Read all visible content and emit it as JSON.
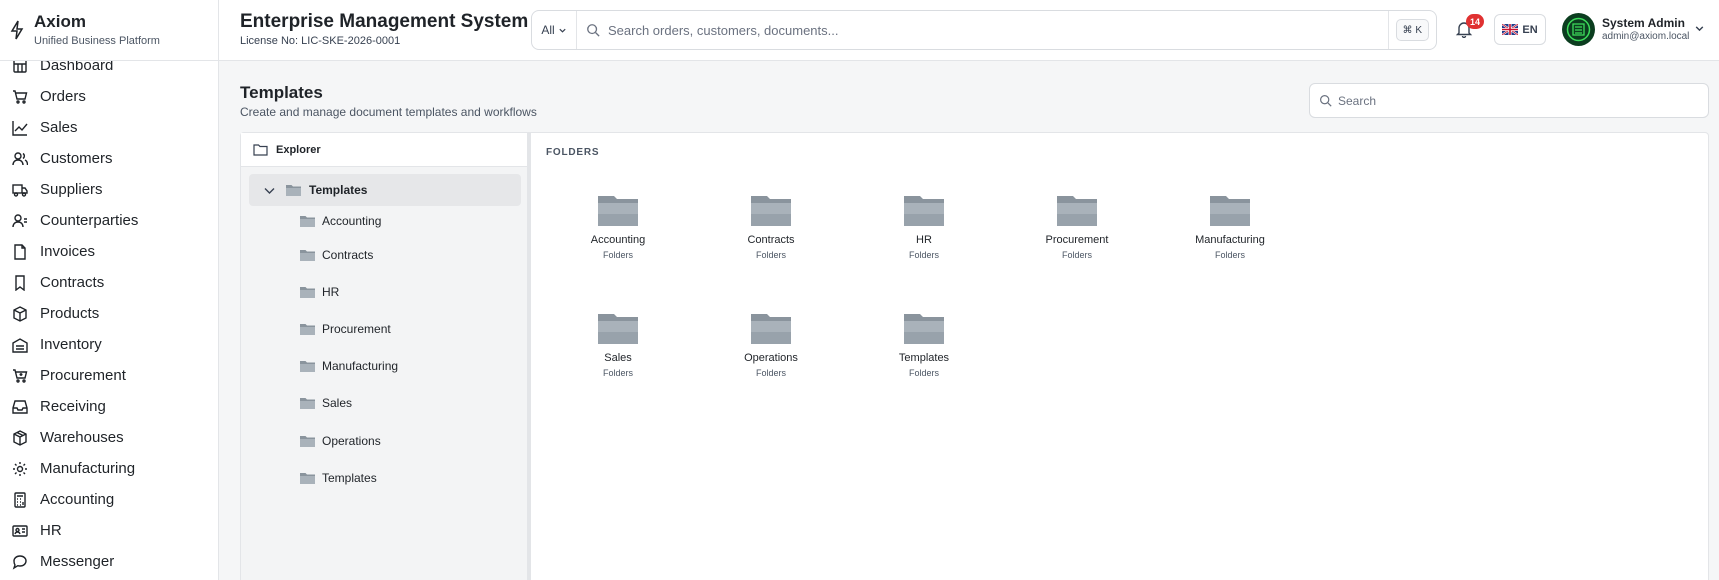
{
  "brand": {
    "name": "Axiom",
    "tagline": "Unified Business Platform"
  },
  "sidebar": {
    "items": [
      {
        "label": "Dashboard",
        "icon": "dashboard-icon"
      },
      {
        "label": "Orders",
        "icon": "cart-icon"
      },
      {
        "label": "Sales",
        "icon": "trend-icon"
      },
      {
        "label": "Customers",
        "icon": "users-icon"
      },
      {
        "label": "Suppliers",
        "icon": "truck-icon"
      },
      {
        "label": "Counterparties",
        "icon": "contact-icon"
      },
      {
        "label": "Invoices",
        "icon": "file-icon"
      },
      {
        "label": "Contracts",
        "icon": "bookmark-icon"
      },
      {
        "label": "Products",
        "icon": "box-icon"
      },
      {
        "label": "Inventory",
        "icon": "warehouse-icon"
      },
      {
        "label": "Procurement",
        "icon": "cart-plus-icon"
      },
      {
        "label": "Receiving",
        "icon": "inbox-icon"
      },
      {
        "label": "Warehouses",
        "icon": "package-icon"
      },
      {
        "label": "Manufacturing",
        "icon": "gear-icon"
      },
      {
        "label": "Accounting",
        "icon": "calculator-icon"
      },
      {
        "label": "HR",
        "icon": "id-card-icon"
      },
      {
        "label": "Messenger",
        "icon": "chat-icon"
      }
    ]
  },
  "header": {
    "title": "Enterprise Management System",
    "license": "License No: LIC-SKE-2026-0001",
    "search": {
      "scope": "All",
      "placeholder": "Search orders, customers, documents...",
      "shortcut": "⌘ K"
    },
    "notifications": "14",
    "language": "EN",
    "user": {
      "name": "System Admin",
      "email": "admin@axiom.local"
    }
  },
  "page": {
    "title": "Templates",
    "subtitle": "Create and manage document templates and workflows",
    "search_placeholder": "Search"
  },
  "explorer": {
    "title": "Explorer",
    "root": "Templates",
    "items": [
      "Accounting",
      "Contracts",
      "HR",
      "Procurement",
      "Manufacturing",
      "Sales",
      "Operations",
      "Templates"
    ]
  },
  "content": {
    "section": "FOLDERS",
    "folders": [
      {
        "name": "Accounting",
        "type": "Folders"
      },
      {
        "name": "Contracts",
        "type": "Folders"
      },
      {
        "name": "HR",
        "type": "Folders"
      },
      {
        "name": "Procurement",
        "type": "Folders"
      },
      {
        "name": "Manufacturing",
        "type": "Folders"
      },
      {
        "name": "Sales",
        "type": "Folders"
      },
      {
        "name": "Operations",
        "type": "Folders"
      },
      {
        "name": "Templates",
        "type": "Folders"
      }
    ]
  },
  "colors": {
    "folder_light": "#a9b2ba",
    "folder_dark": "#8a949d",
    "badge": "#e03131",
    "accent_text": "#1f2328"
  }
}
